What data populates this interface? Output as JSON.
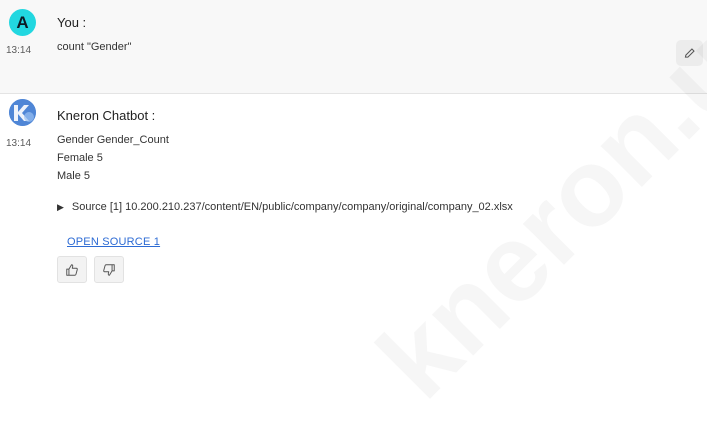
{
  "user": {
    "avatar_letter": "A",
    "author": "You :",
    "time": "13:14",
    "text": "count \"Gender\""
  },
  "bot": {
    "author": "Kneron Chatbot :",
    "time": "13:14",
    "lines": [
      "Gender Gender_Count",
      "Female 5",
      "Male 5"
    ],
    "source": "Source [1] 10.200.210.237/content/EN/public/company/company/original/company_02.xlsx",
    "open_source_label": "OPEN SOURCE 1"
  },
  "watermark": "kneron.u",
  "icons": {
    "edit": "pencil-icon",
    "like": "thumbs-up-icon",
    "dislike": "thumbs-down-icon",
    "source_toggle": "triangle-right-icon"
  },
  "colors": {
    "user_avatar": "#22d7e0",
    "bot_avatar": "#5a8fd8",
    "link": "#2d6bd4"
  }
}
